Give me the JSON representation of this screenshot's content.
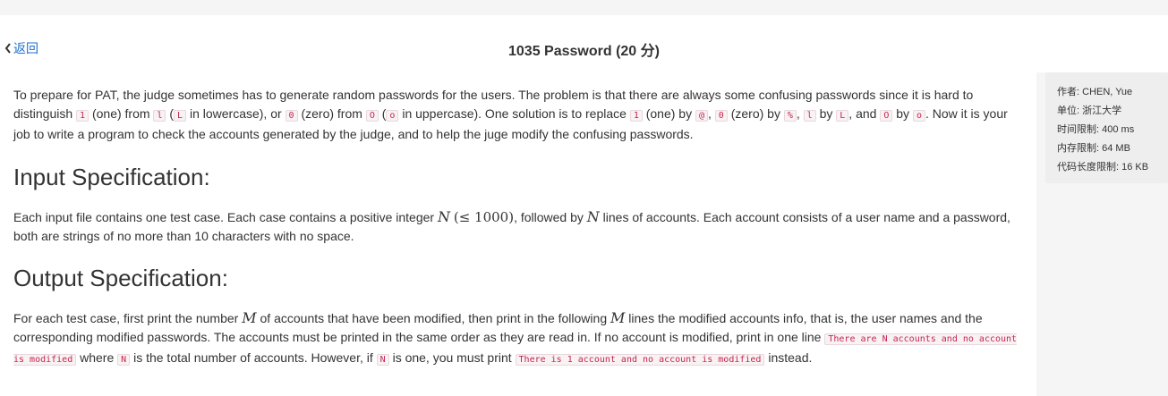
{
  "header": {
    "back_label": "返回",
    "title": "1035 Password (20 分)"
  },
  "problem": {
    "intro": [
      {
        "t": "text",
        "v": "To prepare for PAT, the judge sometimes has to generate random passwords for the users. The problem is that there are always some confusing passwords since it is hard to distinguish "
      },
      {
        "t": "code",
        "v": "1"
      },
      {
        "t": "text",
        "v": " (one) from "
      },
      {
        "t": "code",
        "v": "l"
      },
      {
        "t": "text",
        "v": " ("
      },
      {
        "t": "code",
        "v": "L"
      },
      {
        "t": "text",
        "v": " in lowercase), or "
      },
      {
        "t": "code",
        "v": "0"
      },
      {
        "t": "text",
        "v": " (zero) from "
      },
      {
        "t": "code",
        "v": "O"
      },
      {
        "t": "text",
        "v": " ("
      },
      {
        "t": "code",
        "v": "o"
      },
      {
        "t": "text",
        "v": " in uppercase). One solution is to replace "
      },
      {
        "t": "code",
        "v": "1"
      },
      {
        "t": "text",
        "v": " (one) by "
      },
      {
        "t": "code",
        "v": "@"
      },
      {
        "t": "text",
        "v": ", "
      },
      {
        "t": "code",
        "v": "0"
      },
      {
        "t": "text",
        "v": " (zero) by "
      },
      {
        "t": "code",
        "v": "%"
      },
      {
        "t": "text",
        "v": ", "
      },
      {
        "t": "code",
        "v": "l"
      },
      {
        "t": "text",
        "v": " by "
      },
      {
        "t": "code",
        "v": "L"
      },
      {
        "t": "text",
        "v": ", and "
      },
      {
        "t": "code",
        "v": "O"
      },
      {
        "t": "text",
        "v": " by "
      },
      {
        "t": "code",
        "v": "o"
      },
      {
        "t": "text",
        "v": ". Now it is your job to write a program to check the accounts generated by the judge, and to help the juge modify the confusing passwords."
      }
    ],
    "input_heading": "Input Specification:",
    "input_text": [
      {
        "t": "text",
        "v": "Each input file contains one test case. Each case contains a positive integer "
      },
      {
        "t": "math",
        "v": "N"
      },
      {
        "t": "text",
        "v": " "
      },
      {
        "t": "mathup",
        "v": "(≤ 1000)"
      },
      {
        "t": "text",
        "v": ", followed by "
      },
      {
        "t": "math",
        "v": "N"
      },
      {
        "t": "text",
        "v": " lines of accounts. Each account consists of a user name and a password, both are strings of no more than 10 characters with no space."
      }
    ],
    "output_heading": "Output Specification:",
    "output_text": [
      {
        "t": "text",
        "v": "For each test case, first print the number "
      },
      {
        "t": "math",
        "v": "M"
      },
      {
        "t": "text",
        "v": " of accounts that have been modified, then print in the following "
      },
      {
        "t": "math",
        "v": "M"
      },
      {
        "t": "text",
        "v": " lines the modified accounts info, that is, the user names and the corresponding modified passwords. The accounts must be printed in the same order as they are read in. If no account is modified, print in one line "
      },
      {
        "t": "code",
        "v": "There are N accounts and no account is modified"
      },
      {
        "t": "text",
        "v": " where "
      },
      {
        "t": "code",
        "v": "N"
      },
      {
        "t": "text",
        "v": " is the total number of accounts. However, if "
      },
      {
        "t": "code",
        "v": "N"
      },
      {
        "t": "text",
        "v": " is one, you must print "
      },
      {
        "t": "code",
        "v": "There is 1 account and no account is modified"
      },
      {
        "t": "text",
        "v": " instead."
      }
    ]
  },
  "sidebar": {
    "items": [
      {
        "label": "作者",
        "value": "CHEN, Yue"
      },
      {
        "label": "单位",
        "value": "浙江大学"
      },
      {
        "label": "时间限制",
        "value": "400 ms"
      },
      {
        "label": "内存限制",
        "value": "64 MB"
      },
      {
        "label": "代码长度限制",
        "value": "16 KB"
      }
    ]
  },
  "colors": {
    "link": "#1f6fd1",
    "code_text": "#c7254e",
    "code_bg": "#f9f2f4",
    "sidebar_bg": "#eeeeee",
    "page_bg": "#f5f5f5"
  }
}
